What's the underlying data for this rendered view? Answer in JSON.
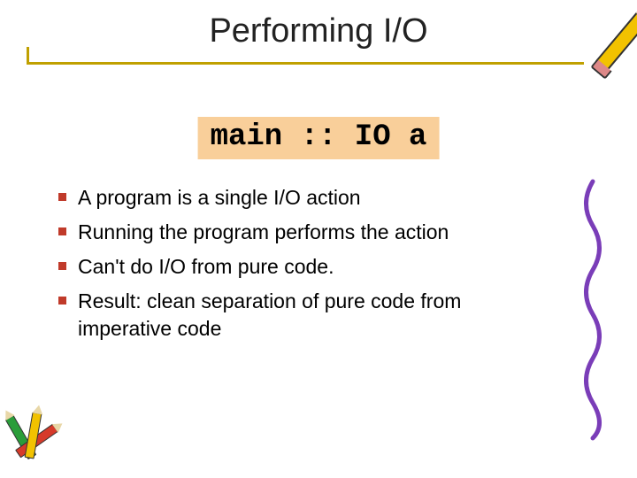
{
  "title": "Performing I/O",
  "code": "main :: IO a",
  "bullets": [
    "A program is a single I/O action",
    "Running the program performs the action",
    "Can't do I/O from pure code.",
    "Result: clean separation of pure code from imperative code"
  ]
}
